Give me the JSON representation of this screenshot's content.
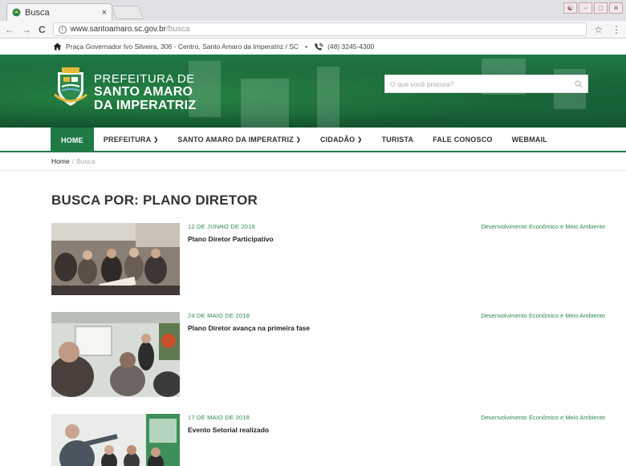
{
  "browser": {
    "tab_title": "Busca",
    "tab_close": "×",
    "url_host": "www.santoamaro.sc.gov.br",
    "url_path": "/busca",
    "back": "←",
    "forward": "→",
    "reload": "C",
    "info": "i",
    "star": "☆",
    "kebab": "⋮"
  },
  "topbar": {
    "address": "Praça Governador Ivo Silveira, 306 - Centro, Santo Amaro da Imperatriz / SC",
    "separator": "•",
    "phone": "(48) 3245-4300"
  },
  "brand": {
    "line1": "PREFEITURA DE",
    "line2": "SANTO AMARO",
    "line3": "DA IMPERATRIZ"
  },
  "search": {
    "placeholder": "O que você procura?"
  },
  "nav": {
    "items": [
      {
        "label": "HOME"
      },
      {
        "label": "PREFEITURA"
      },
      {
        "label": "SANTO AMARO DA IMPERATRIZ"
      },
      {
        "label": "CIDADÃO"
      },
      {
        "label": "TURISTA"
      },
      {
        "label": "FALE CONOSCO"
      },
      {
        "label": "WEBMAIL"
      }
    ]
  },
  "breadcrumb": {
    "home": "Home",
    "sep": "/",
    "current": "Busca"
  },
  "page": {
    "title": "BUSCA POR: PLANO DIRETOR"
  },
  "results": [
    {
      "date": "12 DE JUNHO DE 2018",
      "title": "Plano Diretor Participativo",
      "category": "Desenvolvimento Econômico e Meio Ambiente"
    },
    {
      "date": "24 DE MAIO DE 2018",
      "title": "Plano Diretor avança na primeira fase",
      "category": "Desenvolvimento Econômico e Meio Ambiente"
    },
    {
      "date": "17 DE MAIO DE 2018",
      "title": "Evento Setorial realizado",
      "category": "Desenvolvimento Econômico e Meio Ambiente"
    }
  ],
  "colors": {
    "brand_green": "#1f7a45",
    "link_green": "#2d8a4d"
  }
}
